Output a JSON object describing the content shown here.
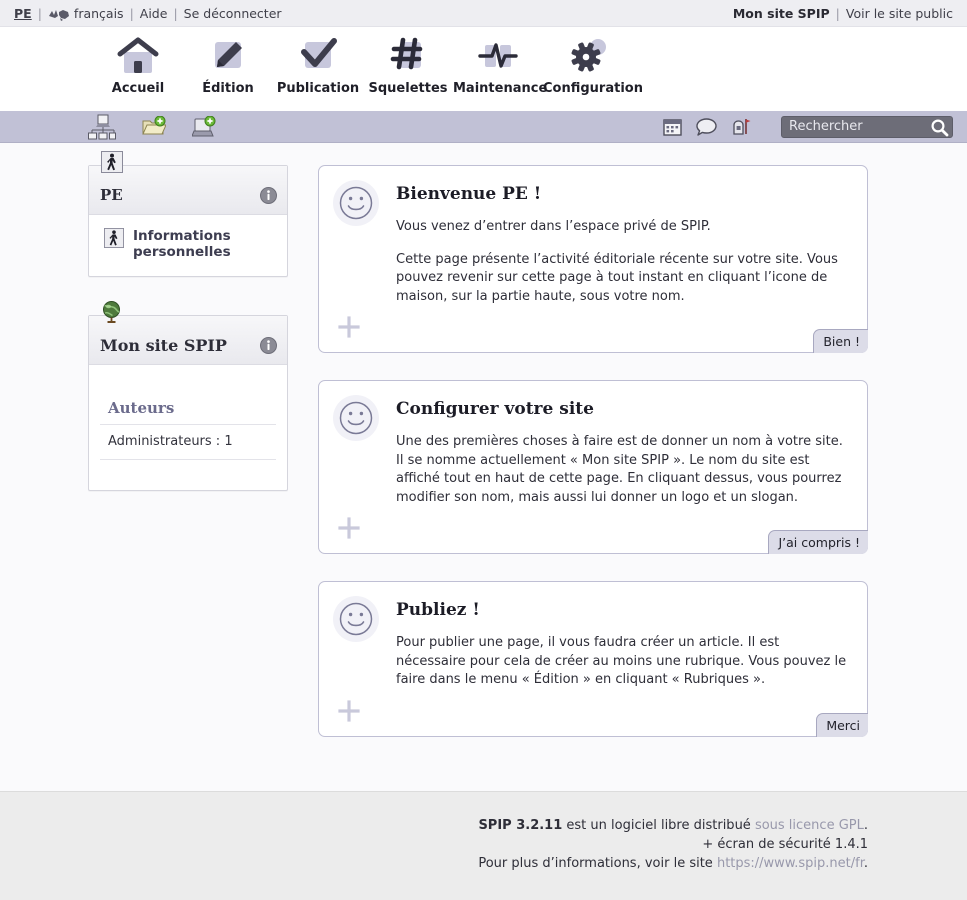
{
  "topbar": {
    "user": "PE",
    "sep": "|",
    "language": "français",
    "help": "Aide",
    "logout": "Se déconnecter",
    "site_name": "Mon site SPIP",
    "public_site": "Voir le site public"
  },
  "mainnav": {
    "items": [
      {
        "label": "Accueil",
        "icon": "home-icon"
      },
      {
        "label": "Édition",
        "icon": "pencil-icon"
      },
      {
        "label": "Publication",
        "icon": "checkmark-icon"
      },
      {
        "label": "Squelettes",
        "icon": "hash-icon"
      },
      {
        "label": "Maintenance",
        "icon": "pulse-icon"
      },
      {
        "label": "Configuration",
        "icon": "gear-icon"
      }
    ]
  },
  "subbar": {
    "tools_left": [
      "site-tree-icon",
      "new-rubrique-icon",
      "new-article-icon"
    ],
    "tools_right": [
      "calendar-icon",
      "forum-icon",
      "messagerie-icon"
    ],
    "search_placeholder": "Rechercher",
    "search_value": ""
  },
  "sidebar": {
    "user_box": {
      "title": "PE",
      "icon": "pedestrian-icon",
      "info_icon": "info-icon",
      "items": [
        {
          "label": "Informations personnelles",
          "icon": "pedestrian-icon"
        }
      ]
    },
    "site_box": {
      "title": "Mon site SPIP",
      "icon": "globe-icon",
      "info_icon": "info-icon",
      "section_title": "Auteurs",
      "rows": [
        {
          "label": "Administrateurs : 1"
        }
      ]
    }
  },
  "messages": [
    {
      "icon": "smiley-icon",
      "title": "Bienvenue PE !",
      "paragraphs": [
        "Vous venez d’entrer dans l’espace privé de SPIP.",
        "Cette page présente l’activité éditoriale récente sur votre site. Vous pouvez revenir sur cette page à tout instant en cliquant l’icone de maison, sur la partie haute, sous votre nom."
      ],
      "button": "Bien !",
      "plus_icon": "plus-icon"
    },
    {
      "icon": "smiley-icon",
      "title": "Configurer votre site",
      "paragraphs": [
        "Une des premières choses à faire est de donner un nom à votre site. Il se nomme actuellement « Mon site SPIP ». Le nom du site est affiché tout en haut de cette page. En cliquant dessus, vous pourrez modifier son nom, mais aussi lui donner un logo et un slogan."
      ],
      "button": "J’ai compris !",
      "plus_icon": "plus-icon"
    },
    {
      "icon": "smiley-icon",
      "title": "Publiez !",
      "paragraphs": [
        "Pour publier une page, il vous faudra créer un article. Il est nécessaire pour cela de créer au moins une rubrique. Vous pouvez le faire dans le menu « Édition » en cliquant « Rubriques »."
      ],
      "button": "Merci",
      "plus_icon": "plus-icon"
    }
  ],
  "footer": {
    "version_label": "SPIP 3.2.11",
    "line1_mid": " est un logiciel libre distribué ",
    "license_link": "sous licence GPL",
    "line1_end": ".",
    "line2": "+ écran de sécurité 1.4.1",
    "line3_start": "Pour plus d’informations, voir le site ",
    "site_link": "https://www.spip.net/fr",
    "line3_end": "."
  },
  "colors": {
    "topbar_bg": "#eeeef2",
    "subbar_bg": "#c1c1d6",
    "page_bg": "#fafafc",
    "footer_bg": "#ececec",
    "accent": "#6b6b8c",
    "icon_fill": "#c7c7dc",
    "icon_dark": "#3d3d4c",
    "search_bg": "#6d6d78",
    "link": "#9898ab"
  }
}
